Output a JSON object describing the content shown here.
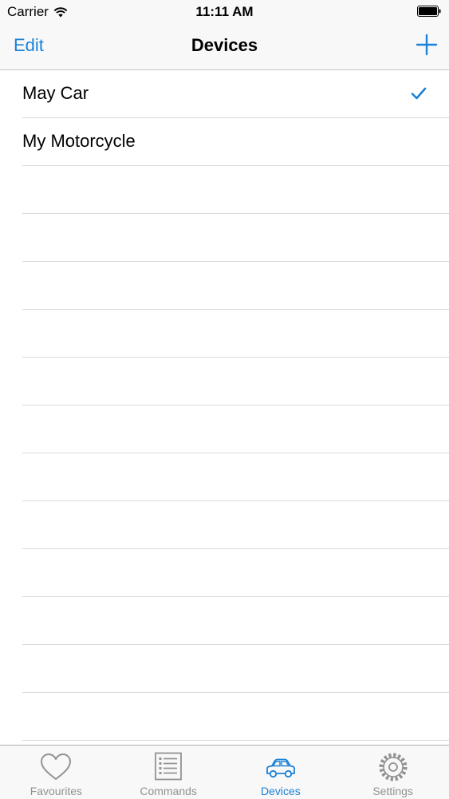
{
  "status_bar": {
    "carrier": "Carrier",
    "time": "11:11 AM"
  },
  "nav": {
    "edit_label": "Edit",
    "title": "Devices"
  },
  "devices": [
    {
      "label": "May Car",
      "selected": true
    },
    {
      "label": "My Motorcycle",
      "selected": false
    }
  ],
  "tabs": [
    {
      "label": "Favourites",
      "icon": "heart-icon",
      "active": false
    },
    {
      "label": "Commands",
      "icon": "list-icon",
      "active": false
    },
    {
      "label": "Devices",
      "icon": "car-icon",
      "active": true
    },
    {
      "label": "Settings",
      "icon": "gear-icon",
      "active": false
    }
  ],
  "colors": {
    "accent": "#1a82d9",
    "inactive": "#929292",
    "bar_background": "#f8f8f8",
    "separator": "#d9d9dd"
  }
}
